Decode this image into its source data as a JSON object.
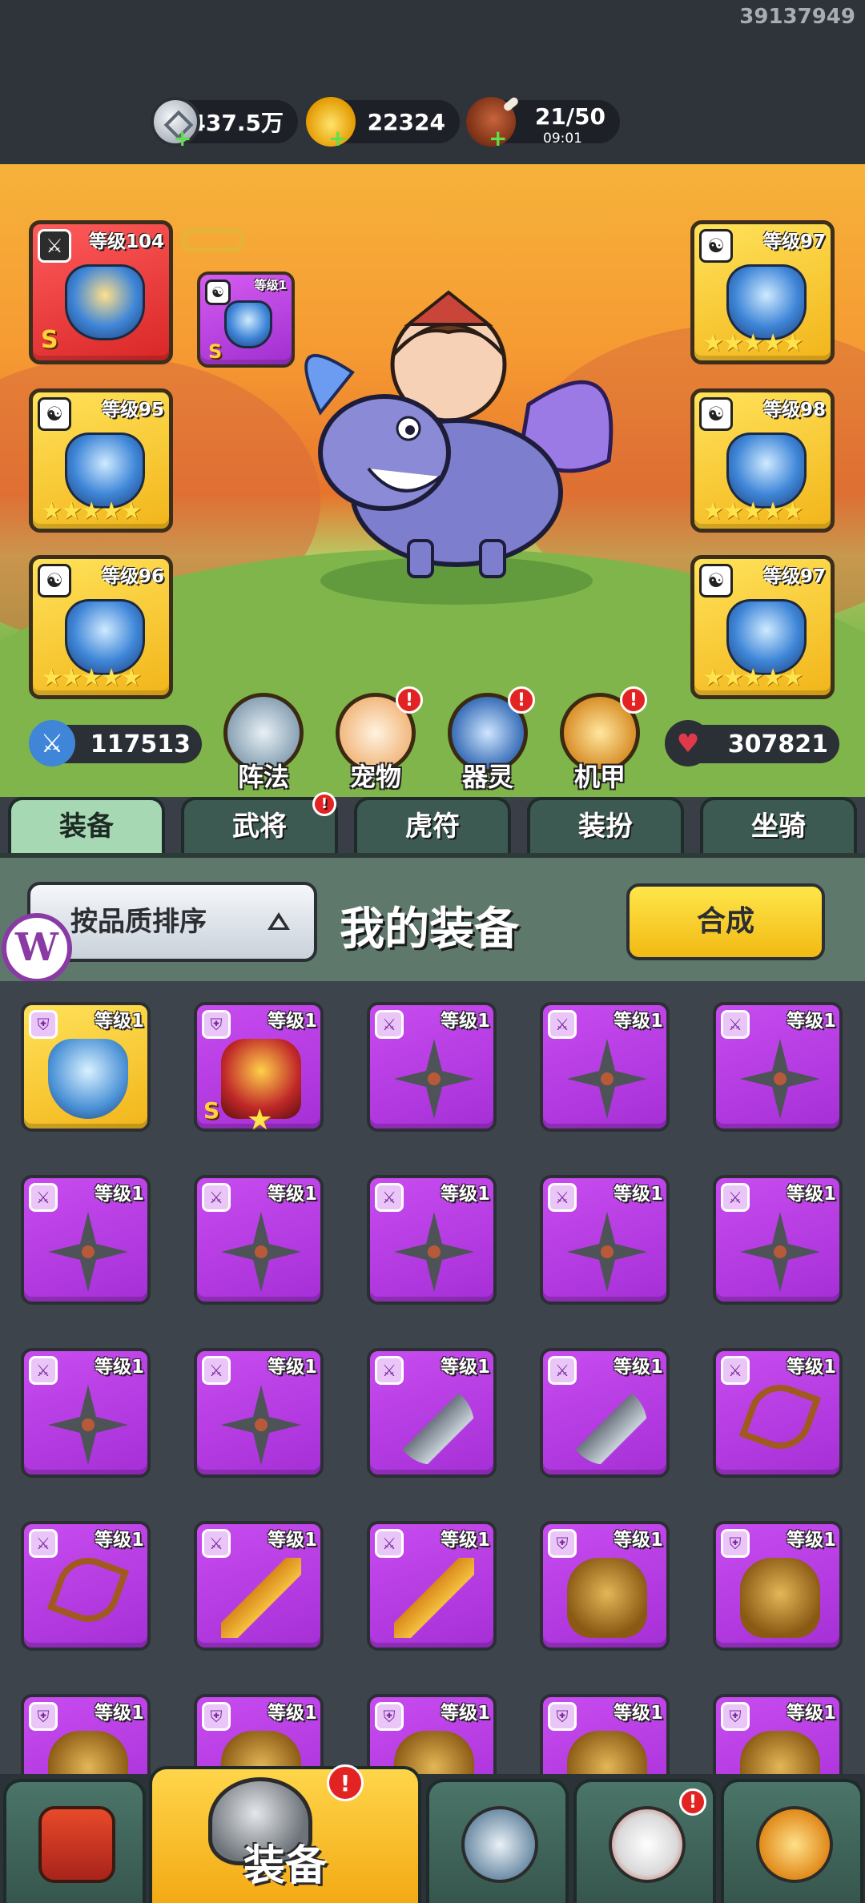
{
  "user_id": "39137949",
  "currencies": [
    {
      "name": "silver",
      "icon": "silver-coin-icon",
      "value": "437.5万"
    },
    {
      "name": "gold",
      "icon": "gold-ingot-icon",
      "value": "22324"
    },
    {
      "name": "stamina",
      "icon": "meat-icon",
      "value": "21/50",
      "timer": "09:01"
    }
  ],
  "equipped_slots": [
    {
      "level": "等级104",
      "grade": "S",
      "icon": "sword-icon"
    },
    {
      "level": "等级1",
      "grade": "S",
      "icon": "yin-yang-icon"
    },
    {
      "level": "等级95",
      "icon": "yin-yang-icon"
    },
    {
      "level": "等级96",
      "icon": "yin-yang-icon"
    },
    {
      "level": "等级97",
      "icon": "yin-yang-icon"
    },
    {
      "level": "等级98",
      "icon": "yin-yang-icon"
    },
    {
      "level": "等级97",
      "icon": "yin-yang-icon"
    }
  ],
  "stats": {
    "attack": "117513",
    "hp": "307821"
  },
  "features": [
    {
      "label": "阵法",
      "badge": false
    },
    {
      "label": "宠物",
      "badge": true
    },
    {
      "label": "器灵",
      "badge": true
    },
    {
      "label": "机甲",
      "badge": true
    }
  ],
  "tabs": [
    {
      "label": "装备",
      "active": true
    },
    {
      "label": "武将",
      "badge": true
    },
    {
      "label": "虎符"
    },
    {
      "label": "装扮"
    },
    {
      "label": "坐骑"
    }
  ],
  "panel": {
    "sort_label": "按品质排序",
    "title": "我的装备",
    "merge_label": "合成"
  },
  "logo_letter": "W",
  "items": [
    {
      "level": "等级1",
      "type": "helmet"
    },
    {
      "level": "等级1",
      "type": "cloak",
      "grade": "S"
    },
    {
      "level": "等级1",
      "type": "shuriken"
    },
    {
      "level": "等级1",
      "type": "shuriken"
    },
    {
      "level": "等级1",
      "type": "shuriken"
    },
    {
      "level": "等级1",
      "type": "shuriken"
    },
    {
      "level": "等级1",
      "type": "shuriken"
    },
    {
      "level": "等级1",
      "type": "shuriken"
    },
    {
      "level": "等级1",
      "type": "shuriken"
    },
    {
      "level": "等级1",
      "type": "shuriken"
    },
    {
      "level": "等级1",
      "type": "shuriken"
    },
    {
      "level": "等级1",
      "type": "shuriken"
    },
    {
      "level": "等级1",
      "type": "knife"
    },
    {
      "level": "等级1",
      "type": "knife"
    },
    {
      "level": "等级1",
      "type": "bow"
    },
    {
      "level": "等级1",
      "type": "bow"
    },
    {
      "level": "等级1",
      "type": "gun"
    },
    {
      "level": "等级1",
      "type": "gun"
    },
    {
      "level": "等级1",
      "type": "armor"
    },
    {
      "level": "等级1",
      "type": "armor"
    },
    {
      "level": "等级1",
      "type": "armor"
    },
    {
      "level": "等级1",
      "type": "armor"
    },
    {
      "level": "等级1",
      "type": "armor"
    },
    {
      "level": "等级1",
      "type": "armor"
    },
    {
      "level": "等级1",
      "type": "armor"
    }
  ],
  "bottom_nav": [
    {
      "name": "city",
      "label": ""
    },
    {
      "name": "equipment",
      "label": "装备",
      "active": true
    },
    {
      "name": "arena",
      "label": ""
    },
    {
      "name": "rooster",
      "label": ""
    },
    {
      "name": "upgrade",
      "label": ""
    }
  ],
  "colors": {
    "accent_gold": "#f2b51a",
    "rare_purple": "#a52fd6",
    "panel_green": "#5f786c",
    "badge_red": "#e32222"
  }
}
